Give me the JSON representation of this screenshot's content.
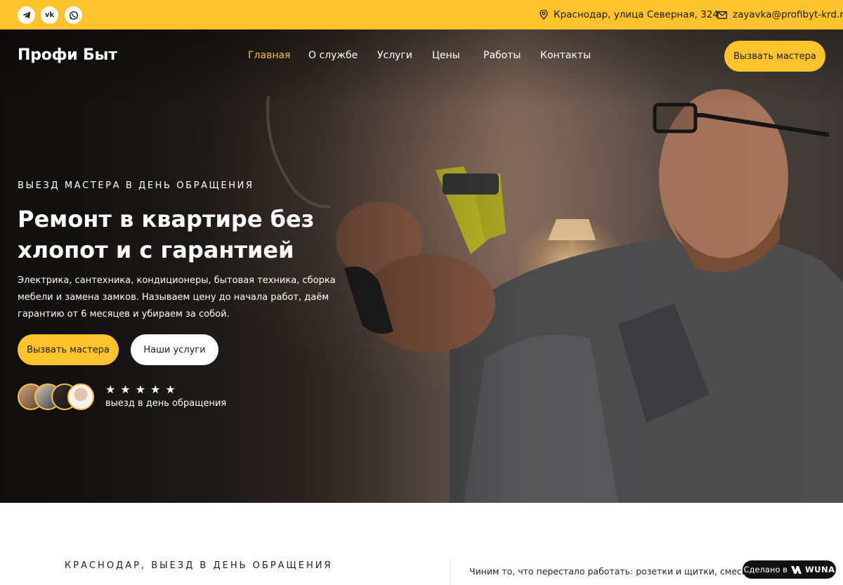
{
  "topbar": {
    "socials": [
      {
        "name": "telegram-icon",
        "label": ""
      },
      {
        "name": "vk-icon",
        "label": "vk"
      },
      {
        "name": "whatsapp-icon",
        "label": ""
      }
    ],
    "address": "Краснодар, улица Северная, 324",
    "email": "zayavka@profibyt-krd.ru"
  },
  "header": {
    "logo": "Профи Быт",
    "nav": [
      "Главная",
      "О службе",
      "Услуги",
      "Цены",
      "Работы",
      "Контакты"
    ],
    "active_nav": "Главная",
    "cta": "Вызвать мастера"
  },
  "hero": {
    "eyebrow": "ВЫЕЗД МАСТЕРА В ДЕНЬ ОБРАЩЕНИЯ",
    "headline": "Ремонт в квартире без хлопот и с гарантией",
    "lead": "Электрика, сантехника, кондиционеры, бытовая техника, сборка мебели и замена замков. Называем цену до начала работ, даём гарантию от 6 месяцев и убираем за собой.",
    "primary_button": "Вызвать мастера",
    "secondary_button": "Наши услуги",
    "rating_stars": 5,
    "rating_text": "выезд в день обращения"
  },
  "section": {
    "eyebrow": "КРАСНОДАР, ВЫЕЗД В ДЕНЬ ОБРАЩЕНИЯ",
    "text": "Чиним то, что перестало работать: розетки и щитки, смесители и с"
  },
  "badge": {
    "prefix": "Сделано в",
    "brand": "WUNA"
  },
  "colors": {
    "accent": "#fdc32c",
    "dark": "#111111"
  }
}
